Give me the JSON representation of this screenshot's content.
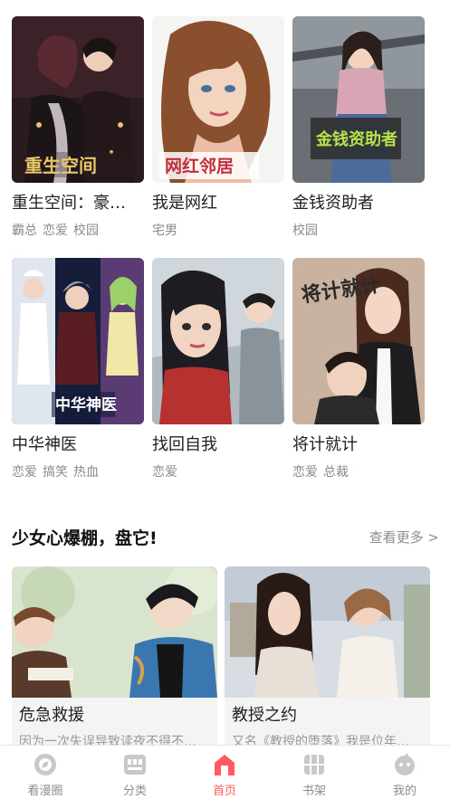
{
  "comics": [
    {
      "title": "重生空间：豪…",
      "tags": [
        "霸总",
        "恋爱",
        "校园"
      ],
      "cover_logo": "重生空间"
    },
    {
      "title": "我是网红",
      "tags": [
        "宅男"
      ],
      "cover_logo": "网红邻居"
    },
    {
      "title": "金钱资助者",
      "tags": [
        "校园"
      ],
      "cover_logo": "金钱资助者"
    },
    {
      "title": "中华神医",
      "tags": [
        "恋爱",
        "搞笑",
        "热血"
      ],
      "cover_logo": "中华神医"
    },
    {
      "title": "找回自我",
      "tags": [
        "恋爱"
      ],
      "cover_logo": ""
    },
    {
      "title": "将计就计",
      "tags": [
        "恋爱",
        "总裁"
      ],
      "cover_logo": "将计就计"
    }
  ],
  "section": {
    "title": "少女心爆棚，盘它!",
    "more": "查看更多 >"
  },
  "features": [
    {
      "title": "危急救援",
      "desc": "因为一次失误导致读夜不得不…"
    },
    {
      "title": "教授之约",
      "desc": "又名《教授的堕落》我是位年…"
    }
  ],
  "tabbar": {
    "items": [
      {
        "label": "看漫圈",
        "icon": "compass-icon"
      },
      {
        "label": "分类",
        "icon": "category-icon"
      },
      {
        "label": "首页",
        "icon": "home-icon"
      },
      {
        "label": "书架",
        "icon": "bookshelf-icon"
      },
      {
        "label": "我的",
        "icon": "profile-icon"
      }
    ],
    "active": "首页",
    "active_color": "#ff5a5f",
    "inactive_color": "#c8c8c8"
  }
}
